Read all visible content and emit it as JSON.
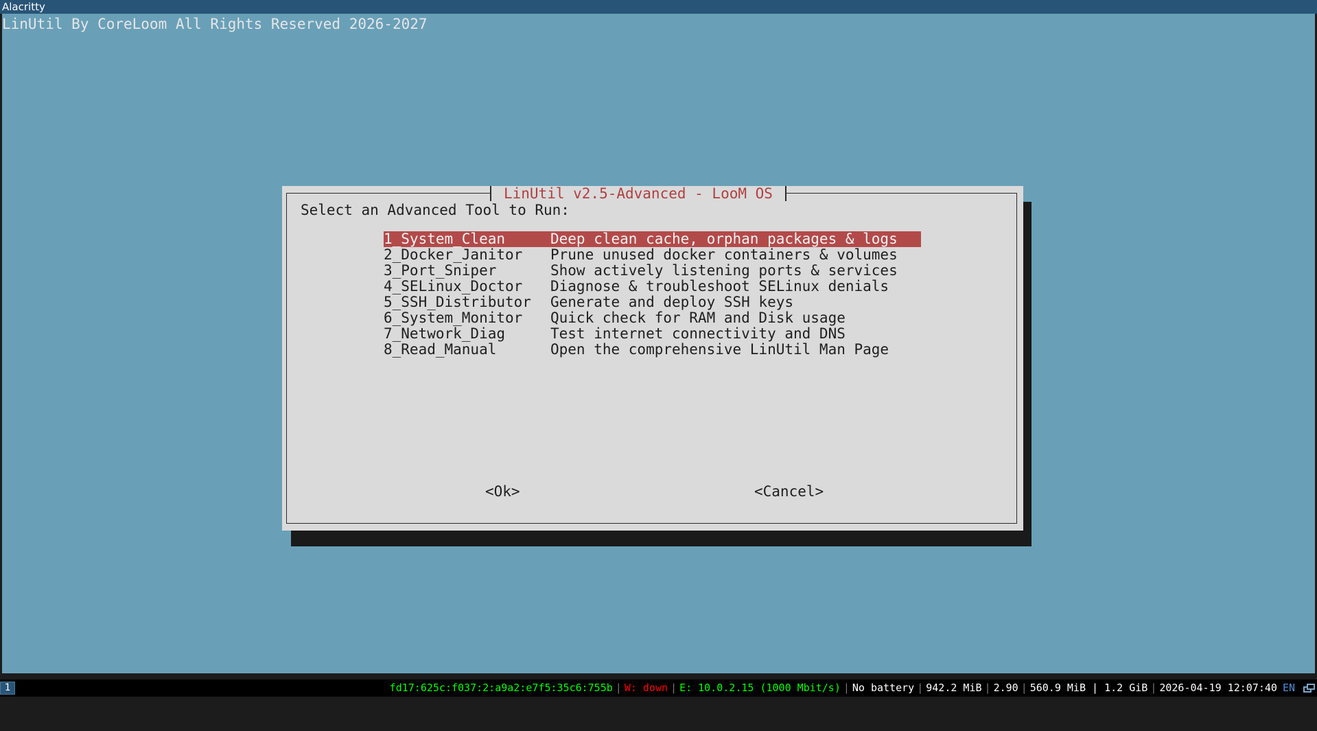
{
  "window": {
    "title": "Alacritty"
  },
  "terminal": {
    "banner": "LinUtil By CoreLoom All Rights Reserved 2026-2027"
  },
  "dialog": {
    "title": "LinUtil v2.5-Advanced - LooM OS",
    "prompt": "Select an Advanced Tool to Run:",
    "items": [
      {
        "tag": "1_System_Clean",
        "desc": "Deep clean cache, orphan packages & logs",
        "selected": true
      },
      {
        "tag": "2_Docker_Janitor",
        "desc": "Prune unused docker containers & volumes"
      },
      {
        "tag": "3_Port_Sniper",
        "desc": "Show actively listening ports & services"
      },
      {
        "tag": "4_SELinux_Doctor",
        "desc": "Diagnose & troubleshoot SELinux denials"
      },
      {
        "tag": "5_SSH_Distributor",
        "desc": "Generate and deploy SSH keys"
      },
      {
        "tag": "6_System_Monitor",
        "desc": "Quick check for RAM and Disk usage"
      },
      {
        "tag": "7_Network_Diag",
        "desc": "Test internet connectivity and DNS"
      },
      {
        "tag": "8_Read_Manual",
        "desc": "Open the comprehensive LinUtil Man Page"
      }
    ],
    "ok_label": "<Ok>",
    "cancel_label": "<Cancel>"
  },
  "statusbar": {
    "workspace": "1",
    "ipv6": "fd17:625c:f037:2:a9a2:e7f5:35c6:755b",
    "wifi": "W: down",
    "ethernet": "E: 10.0.2.15 (1000 Mbit/s)",
    "battery": "No battery",
    "memory_free": "942.2 MiB",
    "load": "2.90",
    "memory_used_total": "560.9 MiB | 1.2 GiB",
    "datetime": "2026-04-19 12:07:40",
    "language": "EN",
    "tray_icon": "window-stack-icon",
    "colors": {
      "ipv6": "#00ff00",
      "wifi": "#ff0000",
      "ethernet": "#00ff00",
      "text": "#ffffff",
      "language": "#4f8fd6"
    }
  }
}
